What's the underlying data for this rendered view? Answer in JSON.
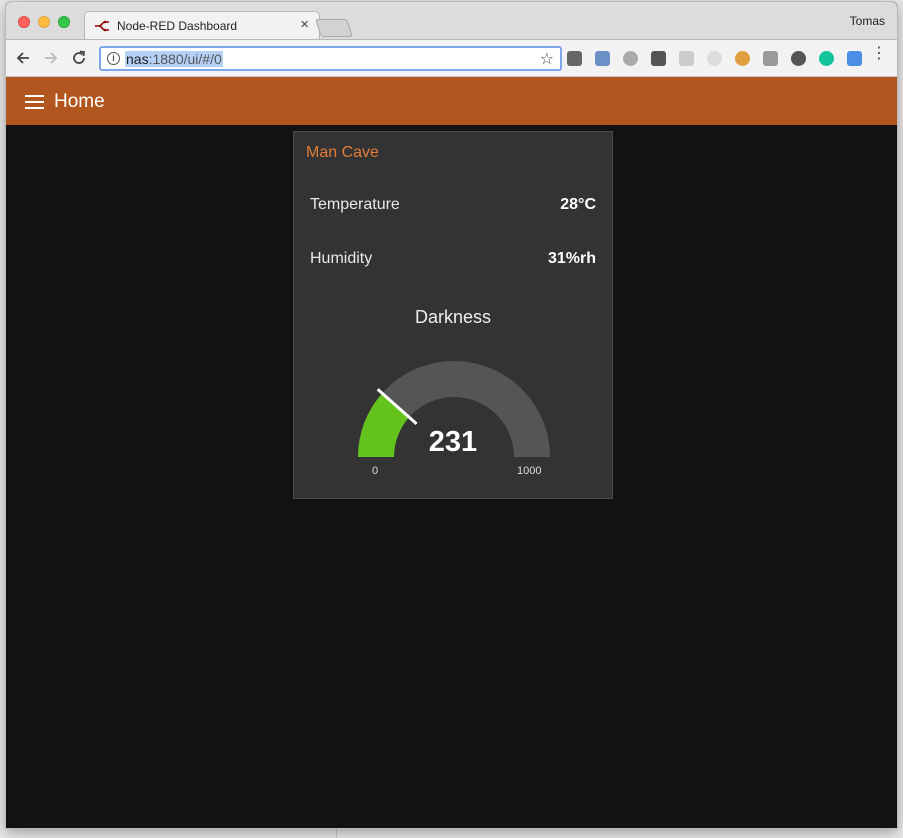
{
  "browser": {
    "tab_title": "Node-RED Dashboard",
    "tab_close": "×",
    "profile_name": "Tomas",
    "url_host": "nas",
    "url_path": ":1880/ui/#/0",
    "extension_icons": [
      "gear-icon",
      "card-icon",
      "circle-icon",
      "check-mail-icon",
      "grid-icon",
      "disc-icon",
      "cookie-icon",
      "image-icon",
      "info-icon",
      "grammarly-icon",
      "translate-icon"
    ]
  },
  "dashboard": {
    "page_title": "Home",
    "header_color": "#b1561e",
    "group": {
      "title": "Man Cave",
      "rows": [
        {
          "label": "Temperature",
          "value": "28°C"
        },
        {
          "label": "Humidity",
          "value": "31%rh"
        }
      ],
      "gauge": {
        "title": "Darkness",
        "value": 231,
        "value_text": "231",
        "min": 0,
        "max": 1000,
        "min_label": "0",
        "max_label": "1000",
        "fill_color": "#64c21c",
        "track_color": "#555555"
      }
    }
  }
}
